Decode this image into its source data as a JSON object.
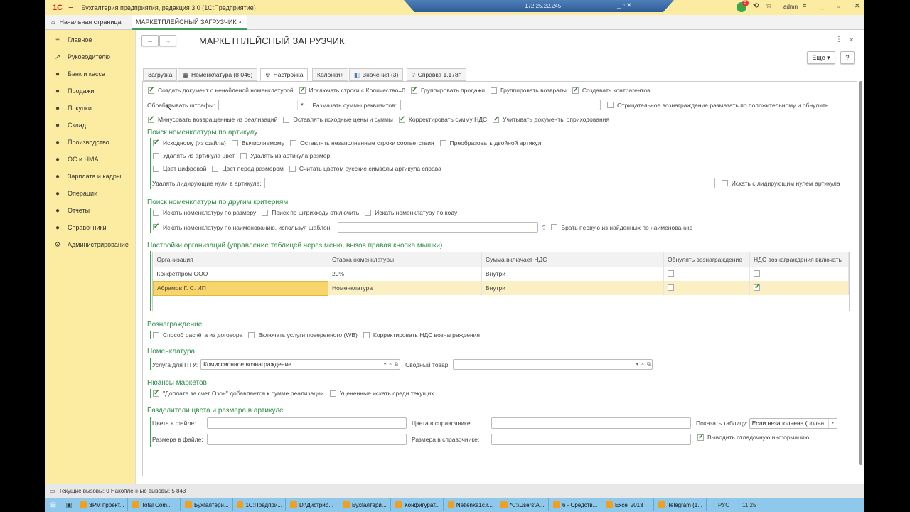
{
  "window": {
    "title": "Бухгалтерия предприятия, редакция 3.0  (1С:Предприятие)",
    "rdp_ip": "172.25.22.245",
    "user": "admn",
    "notif_count": "5"
  },
  "tabs": {
    "home": "Начальная страница",
    "active": "МАРКЕТПЛЕЙСНЫЙ ЗАГРУЗЧИК ×"
  },
  "sidebar": {
    "items": [
      {
        "label": "Главное",
        "icon": "≡"
      },
      {
        "label": "Руководителю",
        "icon": "↗"
      },
      {
        "label": "Банк и касса",
        "icon": "●"
      },
      {
        "label": "Продажи",
        "icon": "●"
      },
      {
        "label": "Покупки",
        "icon": "●"
      },
      {
        "label": "Склад",
        "icon": "●"
      },
      {
        "label": "Производство",
        "icon": "●"
      },
      {
        "label": "ОС и НМА",
        "icon": "●"
      },
      {
        "label": "Зарплата и кадры",
        "icon": "●"
      },
      {
        "label": "Операции",
        "icon": "●"
      },
      {
        "label": "Отчеты",
        "icon": "●"
      },
      {
        "label": "Справочники",
        "icon": "●"
      },
      {
        "label": "Администрирование",
        "icon": "⚙"
      }
    ]
  },
  "form": {
    "title": "МАРКЕТПЛЕЙСНЫЙ ЗАГРУЗЧИК",
    "more": "Еще ▾",
    "help": "?",
    "tabs": [
      "Загрузка",
      "Номенклатура (8 046)",
      "Настройка",
      "Колонки+",
      "Значения (3)",
      "Справка 1.178п"
    ]
  },
  "general": {
    "row1": [
      {
        "label": "Создать документ с ненайденой номенклатурой",
        "checked": true
      },
      {
        "label": "Исключать строки с Количество=0",
        "checked": true
      },
      {
        "label": "Группировать продажи",
        "checked": true
      },
      {
        "label": "Группировать возвраты",
        "checked": false
      },
      {
        "label": "Создавать контрагентов",
        "checked": true
      }
    ],
    "fines_label": "Обрабатывать штрафы:",
    "fines_value": "",
    "spread_label": "Размазать суммы реквизитов:",
    "spread_value": "",
    "neg_reward": {
      "label": "Отрицательное вознаграждение размазать по положительному и обнулить",
      "checked": false
    },
    "row3": [
      {
        "label": "Минусовать возвращенные из реализаций",
        "checked": true
      },
      {
        "label": "Оставлять исходные цены и суммы",
        "checked": false
      },
      {
        "label": "Корректировать сумму НДС",
        "checked": true
      },
      {
        "label": "Учитывать документы оприходования",
        "checked": true
      }
    ]
  },
  "article": {
    "title": "Поиск номенклатуры по артикулу",
    "row1": [
      {
        "label": "Исходному (из файла)",
        "checked": true
      },
      {
        "label": "Вычисляемому",
        "checked": false
      },
      {
        "label": "Оставлять незаполненные строки соответствия",
        "checked": false
      },
      {
        "label": "Преобразовать двойной артикул",
        "checked": false
      }
    ],
    "row2": [
      {
        "label": "Удалять из артикула цвет",
        "checked": false
      },
      {
        "label": "Удалять из артикула размер",
        "checked": false
      }
    ],
    "row3": [
      {
        "label": "Цвет цифровой",
        "checked": false
      },
      {
        "label": "Цвет перед размером",
        "checked": false
      },
      {
        "label": "Считать цветом русские символы артикула справа",
        "checked": false
      }
    ],
    "zeros_label": "Удалять лидирующие нули в артикуле:",
    "zeros_value": "",
    "zeros_search": {
      "label": "Искать с лидирующим нулем артикула",
      "checked": false
    }
  },
  "other": {
    "title": "Поиск номенклатуры по другим критериям",
    "row1": [
      {
        "label": "Искать номенклатуру по размеру",
        "checked": false
      },
      {
        "label": "Поиск по штрихкоду отключить",
        "checked": false
      },
      {
        "label": "Искать номенклатуру по коду",
        "checked": false
      }
    ],
    "by_name": {
      "label": "Искать номенклатуру по наименованию, используя шаблон:",
      "checked": true
    },
    "template_value": "",
    "q": "?",
    "first": {
      "label": "Брать первую из найденных по наименованию",
      "checked": false
    }
  },
  "orgs": {
    "title": "Настройки организаций (управление таблицей через меню, вызов правая кнопка мышки)",
    "columns": [
      "Организация",
      "Ставка номенклатуры",
      "Сумма включает НДС",
      "Обнулять вознаграждение",
      "НДС вознаграждения включать"
    ],
    "rows": [
      {
        "org": "Конфетпром ООО",
        "rate": "20%",
        "vat": "Внутри",
        "zero": false,
        "vat_reward": false
      },
      {
        "org": "Абрамов Г. С. ИП",
        "rate": "Номенклатура",
        "vat": "Внутри",
        "zero": false,
        "vat_reward": true
      }
    ]
  },
  "reward": {
    "title": "Вознаграждение",
    "items": [
      {
        "label": "Способ расчёта из договора",
        "checked": false
      },
      {
        "label": "Включать услуги поверенного (WB)",
        "checked": false
      },
      {
        "label": "Корректировать НДС вознаграждения",
        "checked": false
      }
    ]
  },
  "nomen": {
    "title": "Номенклатура",
    "service_label": "Услуга для ПТУ:",
    "service_value": "Комиссионное вознаграждение",
    "summary_label": "Сводный товар:",
    "summary_value": ""
  },
  "nuances": {
    "title": "Нюансы маркетов",
    "items": [
      {
        "label": "\"Доплата за счет Озон\" добавляется к сумме реализации",
        "checked": true
      },
      {
        "label": "Уцененные искать среди текущих",
        "checked": false
      }
    ]
  },
  "separators": {
    "title": "Разделители цвета и размера в артикуле",
    "color_file": "Цвета в файле:",
    "color_ref": "Цвета в справочнике:",
    "size_file": "Размера в файле:",
    "size_ref": "Размера в справочнике:",
    "show_table_label": "Показать таблицу:",
    "show_table_value": "Если незаполнена (полна",
    "debug": {
      "label": "Выводить отладочную информацию",
      "checked": true
    }
  },
  "status": {
    "text": "Текущие вызовы: 0   Накопленные вызовы: 5 843"
  },
  "taskbar": {
    "items": [
      "ЗРМ проект...",
      "Total Com...",
      "Бухгалтери...",
      "1С:Предпри...",
      "D:\\Дистриб...",
      "Бухгалтери...",
      "Конфигурат...",
      "Netlenka1c.r...",
      "*C:\\Users\\A...",
      "6 - Средств...",
      "Excel 2013",
      "Telegram (1..."
    ],
    "lang": "РУС",
    "time": "11:25"
  }
}
